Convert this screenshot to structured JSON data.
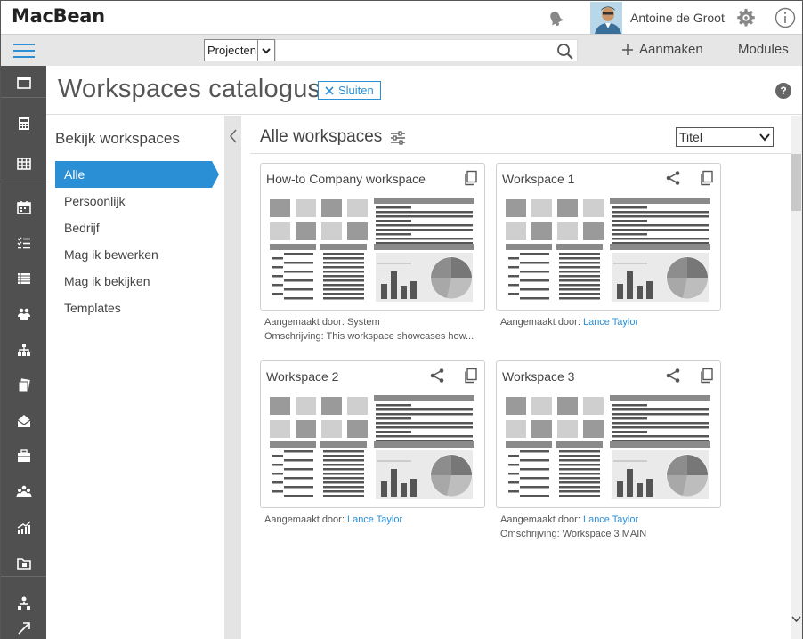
{
  "app": {
    "logo": "MacBean"
  },
  "header": {
    "user_name": "Antoine de Groot"
  },
  "search": {
    "scope": "Projecten",
    "placeholder": ""
  },
  "toolbar": {
    "create_label": "Aanmaken",
    "modules_label": "Modules"
  },
  "page": {
    "title": "Workspaces catalogus",
    "close_label": "Sluiten",
    "help_label": "?"
  },
  "filter": {
    "title": "Bekijk workspaces",
    "items": [
      {
        "label": "Alle",
        "active": true
      },
      {
        "label": "Persoonlijk",
        "active": false
      },
      {
        "label": "Bedrijf",
        "active": false
      },
      {
        "label": "Mag ik bewerken",
        "active": false
      },
      {
        "label": "Mag ik bekijken",
        "active": false
      },
      {
        "label": "Templates",
        "active": false
      }
    ]
  },
  "main": {
    "title": "Alle workspaces",
    "sort_value": "Titel"
  },
  "cards": [
    {
      "title": "How-to Company workspace",
      "created_label": "Aangemaakt door:",
      "created_by": "System",
      "description_label": "Omschrijving:",
      "description": "This workspace showcases how..."
    },
    {
      "title": "Workspace 1",
      "created_label": "Aangemaakt door:",
      "created_by": "Lance Taylor"
    },
    {
      "title": "Workspace 2",
      "created_label": "Aangemaakt door:",
      "created_by": "Lance Taylor"
    },
    {
      "title": "Workspace 3",
      "created_label": "Aangemaakt door:",
      "created_by": "Lance Taylor",
      "description_label": "Omschrijving:",
      "description": "Workspace 3 MAIN"
    }
  ],
  "colors": {
    "accent": "#2b8fd6",
    "rail": "#505050",
    "searchbar": "#e6e6e6"
  },
  "rail_icons": [
    "dashboard-icon",
    "calculator-icon",
    "grid-icon",
    "calendar-icon",
    "checklist-icon",
    "list-icon",
    "team-icon",
    "org-chart-icon",
    "documents-icon",
    "mail-icon",
    "briefcase-icon",
    "people-icon",
    "chart-icon",
    "folder-icon",
    "network-icon",
    "expand-icon"
  ]
}
